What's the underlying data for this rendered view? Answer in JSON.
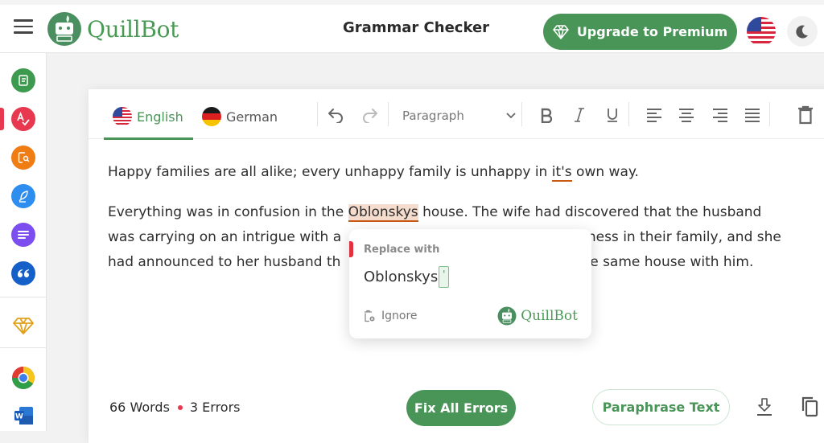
{
  "header": {
    "brand": "QuillBot",
    "title": "Grammar Checker",
    "premium_label": "Upgrade to Premium",
    "menu_icon": "hamburger-icon",
    "language_flag": "us-flag-icon",
    "theme_icon": "moon-icon"
  },
  "sidebar": {
    "items": [
      {
        "name": "paraphraser",
        "icon": "paraphraser-icon",
        "color": "#3e9a4f"
      },
      {
        "name": "grammar-checker",
        "icon": "grammar-check-icon",
        "color": "#e8384f",
        "active": true
      },
      {
        "name": "plagiarism-checker",
        "icon": "plagiarism-icon",
        "color": "#f07c14"
      },
      {
        "name": "co-writer",
        "icon": "quill-icon",
        "color": "#2d8ef0"
      },
      {
        "name": "summarizer",
        "icon": "summarizer-icon",
        "color": "#7c4ef0"
      },
      {
        "name": "citation-generator",
        "icon": "quote-icon",
        "color": "#1560c8"
      },
      {
        "name": "premium",
        "icon": "diamond-icon",
        "color": "#e0a21b"
      },
      {
        "name": "chrome-extension",
        "icon": "chrome-icon"
      },
      {
        "name": "word-addin",
        "icon": "word-icon"
      }
    ]
  },
  "toolbar": {
    "languages": [
      {
        "label": "English",
        "active": true
      },
      {
        "label": "German",
        "active": false
      }
    ],
    "paragraph_select": "Paragraph",
    "tools": [
      "undo",
      "redo",
      "bold",
      "italic",
      "underline",
      "align-left",
      "align-center",
      "align-right",
      "justify",
      "delete"
    ]
  },
  "editor": {
    "p1_before": "Happy families are all alike; every unhappy family is unhappy in ",
    "p1_error": "it's",
    "p1_after": " own way.",
    "p2_line1_before": "Everything was in confusion in the ",
    "p2_error": "Oblonskys",
    "p2_line1_after": " house. The wife had discovered that the husband",
    "p2_line2_left": "was carrying on an intrigue with a",
    "p2_line2_right": "rness in their family, and she",
    "p2_line3_left": "had announced to her husband th",
    "p2_line3_right": "he same house with him."
  },
  "popup": {
    "label": "Replace with",
    "suggestion": "Oblonskys",
    "insertion": "'",
    "ignore_label": "Ignore",
    "brand": "QuillBot"
  },
  "footer": {
    "words": "66 Words",
    "errors": "3 Errors",
    "fix_label": "Fix All Errors",
    "paraphrase_label": "Paraphrase Text"
  },
  "colors": {
    "brand_green": "#499557",
    "error_red": "#e8384f",
    "error_underline": "#c85a14"
  }
}
